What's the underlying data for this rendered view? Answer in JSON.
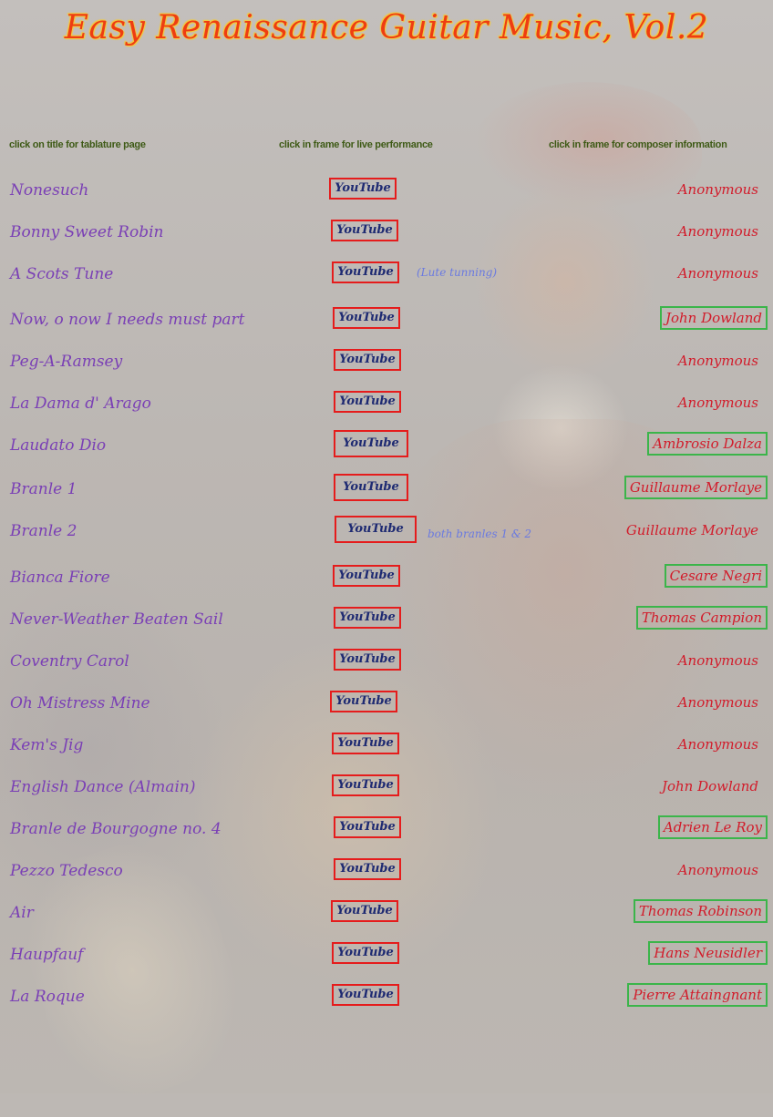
{
  "title": "Easy Renaissance Guitar Music, Vol.2",
  "hints": {
    "tablature": "click on title for tablature page",
    "performance": "click in frame for live performance",
    "composer": "click in frame for composer information"
  },
  "youtube_label": "YouTube",
  "colors": {
    "title": "#ee3d12",
    "title_glow": "#f5c638",
    "song": "#7a3fb5",
    "youtube_frame": "#e51c1c",
    "youtube_text": "#1e2a72",
    "composer": "#d21b2a",
    "composer_frame": "#3bb54a",
    "note": "#6a7ae0",
    "hint": "#3e5a16"
  },
  "rows": [
    {
      "song": "Nonesuch",
      "composer": "Anonymous",
      "composer_framed": false,
      "note": ""
    },
    {
      "song": "Bonny Sweet Robin",
      "composer": "Anonymous",
      "composer_framed": false,
      "note": ""
    },
    {
      "song": "A Scots Tune",
      "composer": "Anonymous",
      "composer_framed": false,
      "note": "(Lute tunning)"
    },
    {
      "song": "Now, o now I needs must part",
      "composer": "John Dowland",
      "composer_framed": true,
      "note": ""
    },
    {
      "song": "Peg-A-Ramsey",
      "composer": "Anonymous",
      "composer_framed": false,
      "note": ""
    },
    {
      "song": "La Dama d' Arago",
      "composer": "Anonymous",
      "composer_framed": false,
      "note": ""
    },
    {
      "song": "Laudato Dio",
      "composer": "Ambrosio Dalza",
      "composer_framed": true,
      "note": ""
    },
    {
      "song": "Branle 1",
      "composer": "Guillaume Morlaye",
      "composer_framed": true,
      "note": ""
    },
    {
      "song": "Branle 2",
      "composer": "Guillaume Morlaye",
      "composer_framed": false,
      "note": "both branles 1 & 2"
    },
    {
      "song": "Bianca Fiore",
      "composer": "Cesare Negri",
      "composer_framed": true,
      "note": ""
    },
    {
      "song": "Never-Weather Beaten Sail",
      "composer": "Thomas Campion",
      "composer_framed": true,
      "note": ""
    },
    {
      "song": "Coventry Carol",
      "composer": "Anonymous",
      "composer_framed": false,
      "note": ""
    },
    {
      "song": "Oh Mistress Mine",
      "composer": "Anonymous",
      "composer_framed": false,
      "note": ""
    },
    {
      "song": "Kem's Jig",
      "composer": "Anonymous",
      "composer_framed": false,
      "note": ""
    },
    {
      "song": "English Dance (Almain)",
      "composer": "John Dowland",
      "composer_framed": false,
      "note": ""
    },
    {
      "song": "Branle de Bourgogne no. 4",
      "composer": "Adrien Le Roy",
      "composer_framed": true,
      "note": ""
    },
    {
      "song": "Pezzo Tedesco",
      "composer": "Anonymous",
      "composer_framed": false,
      "note": ""
    },
    {
      "song": "Air",
      "composer": "Thomas Robinson",
      "composer_framed": true,
      "note": ""
    },
    {
      "song": "Haupfauf",
      "composer": "Hans Neusidler",
      "composer_framed": true,
      "note": ""
    },
    {
      "song": "La Roque",
      "composer": "Pierre Attaingnant",
      "composer_framed": true,
      "note": ""
    }
  ]
}
